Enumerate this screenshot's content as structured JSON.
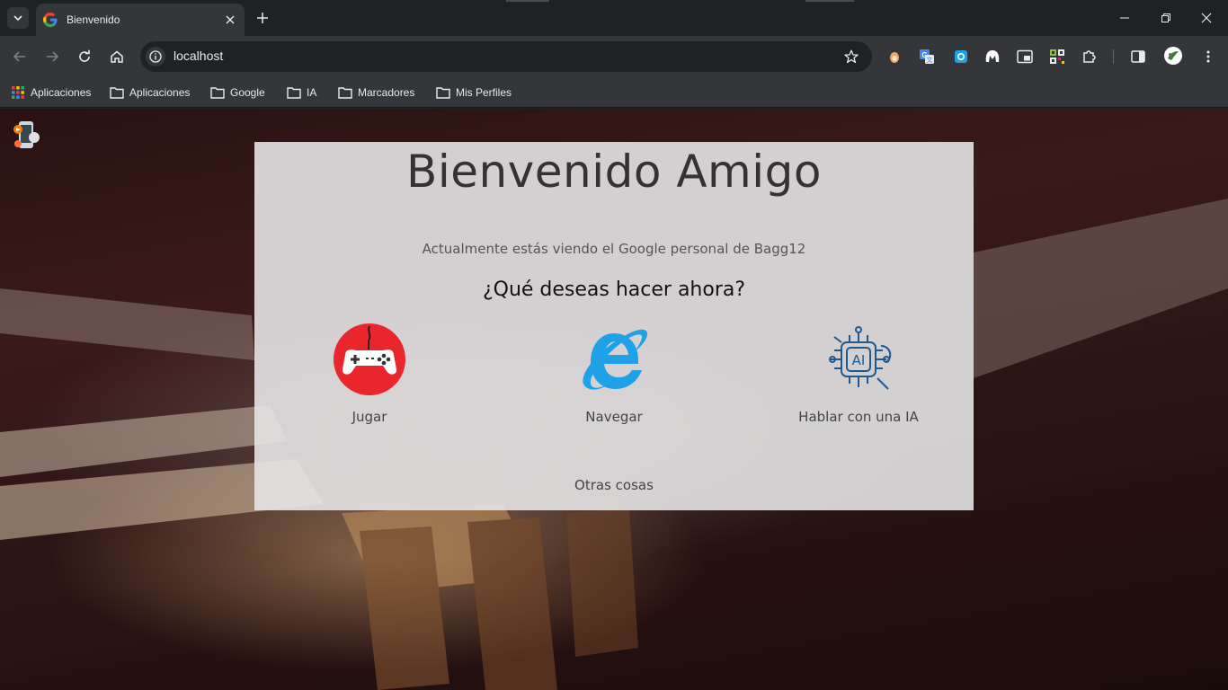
{
  "browser": {
    "tab": {
      "title": "Bienvenido"
    },
    "address_bar": {
      "url": "localhost"
    },
    "bookmarks": [
      {
        "label": "Aplicaciones",
        "icon": "apps-grid-icon"
      },
      {
        "label": "Aplicaciones",
        "icon": "folder-icon"
      },
      {
        "label": "Google",
        "icon": "folder-icon"
      },
      {
        "label": "IA",
        "icon": "folder-icon"
      },
      {
        "label": "Marcadores",
        "icon": "folder-icon"
      },
      {
        "label": "Mis Perfiles",
        "icon": "folder-icon"
      }
    ],
    "extensions": [
      "extension-orange-icon",
      "google-translate-icon",
      "screen-capture-icon",
      "malwarebytes-icon",
      "picture-in-picture-icon",
      "qr-code-icon",
      "puzzle-icon"
    ]
  },
  "page": {
    "title": "Bienvenido Amigo",
    "subtitle": "Actualmente estás viendo el Google personal de Bagg12",
    "question": "¿Qué deseas hacer ahora?",
    "options": [
      {
        "label": "Jugar",
        "icon": "gamepad-icon"
      },
      {
        "label": "Navegar",
        "icon": "internet-explorer-icon"
      },
      {
        "label": "Hablar con una IA",
        "icon": "ai-chip-icon"
      }
    ],
    "other": "Otras cosas"
  },
  "colors": {
    "chrome_dark": "#202124",
    "chrome_toolbar": "#35363a",
    "gamepad_red": "#e8262b",
    "ie_blue": "#1ea1e6",
    "ai_blue": "#1f5a8f"
  }
}
